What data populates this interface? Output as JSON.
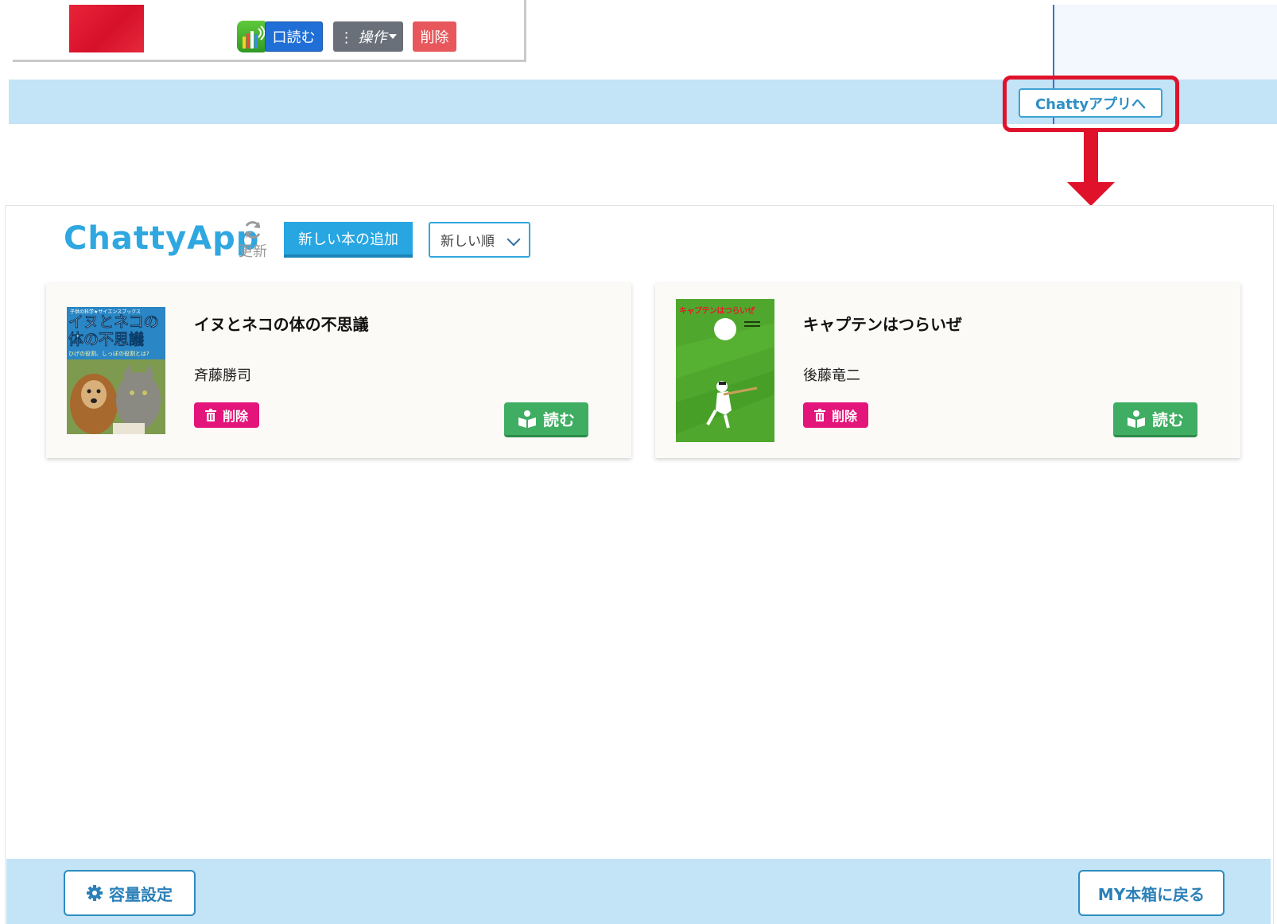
{
  "toolbar": {
    "read_label": "口読む",
    "ops_label": "⋮ 操作",
    "delete_label": "削除"
  },
  "band": {
    "chatty_button_label": "Chattyアプリへ"
  },
  "app": {
    "title": "ChattyApp",
    "refresh_label": "更新",
    "add_book_label": "新しい本の追加",
    "sort_selected": "新しい順"
  },
  "books": [
    {
      "title": "イヌとネコの体の不思議",
      "author": "斉藤勝司",
      "delete_label": "削除",
      "read_label": "読む",
      "cover": {
        "series": "子供の科学★サイエンスブックス",
        "line1": "イヌとネコの",
        "line2": "体の不思議",
        "subtitle": "ひげの役割、しっぽの役割とは?"
      }
    },
    {
      "title": "キャプテンはつらいぜ",
      "author": "後藤竜二",
      "delete_label": "削除",
      "read_label": "読む",
      "cover": {
        "title": "キャプテンはつらいぜ"
      }
    }
  ],
  "footer": {
    "capacity_label": "容量設定",
    "back_label": "MY本箱に戻る"
  },
  "colors": {
    "accent": "#2fa7e0",
    "band": "#c3e3f6",
    "highlight": "#e0122b",
    "delete": "#e3157a",
    "read": "#3fad62"
  }
}
